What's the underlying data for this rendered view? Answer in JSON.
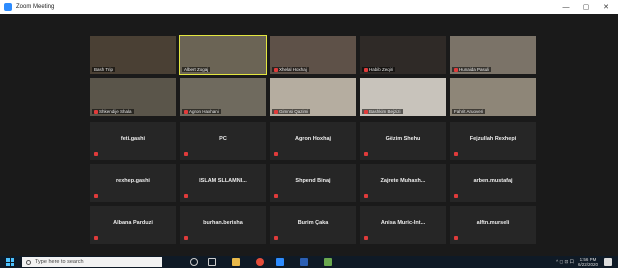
{
  "window": {
    "title": "Zoom Meeting",
    "minimize": "—",
    "maximize": "▢",
    "close": "✕"
  },
  "video_tiles": [
    {
      "name": "Bash Trip",
      "muted": false,
      "active": false,
      "bg": "#4a4034"
    },
    {
      "name": "Albert Zogaj",
      "muted": false,
      "active": true,
      "bg": "#6b6455"
    },
    {
      "name": "Xhelal Hoxhaj",
      "muted": true,
      "active": false,
      "bg": "#5e5148"
    },
    {
      "name": "Habib Zeqiri",
      "muted": true,
      "active": false,
      "bg": "#2f2a27"
    },
    {
      "name": "Hunaida Pasuli",
      "muted": true,
      "active": false,
      "bg": "#7b7368"
    },
    {
      "name": "Shkendije Shala",
      "muted": true,
      "active": false,
      "bg": "#5a554a"
    },
    {
      "name": "Agron Haxhani",
      "muted": true,
      "active": false,
      "bg": "#6f6a5e"
    },
    {
      "name": "Gimnsi Qazimi",
      "muted": true,
      "active": false,
      "bg": "#b5ada0"
    },
    {
      "name": "Bashkim Bejzizi",
      "muted": true,
      "active": false,
      "bg": "#c8c3bb"
    },
    {
      "name": "Fahrit Aruoveri",
      "muted": false,
      "active": false,
      "bg": "#8e8678"
    }
  ],
  "name_tiles": [
    "feti.gashi",
    "PC",
    "Agron Hoxhaj",
    "Gëzim Shehu",
    "Fejzullah Rexhepi",
    "rexhep.gashi",
    "ISLAM SLLAMNI...",
    "Shpend Binaj",
    "Zajrete Muhaxh...",
    "arben.mustafaj",
    "Albana Parduzi",
    "burhan.berisha",
    "Burim Çaka",
    "Anisa Muric-Int...",
    "alftn.murseli"
  ],
  "taskbar": {
    "search_placeholder": "Type here to search",
    "time": "1:56 PM",
    "date": "6/22/2020",
    "tray_text": "^ ◻ ⊡ 口"
  },
  "colors": {
    "mute": "#e03b3b",
    "active_border": "#e3e640",
    "stage": "#1a1a1a",
    "tile": "#262626"
  },
  "icons": [
    "windows-logo-icon",
    "search-icon",
    "task-view-icon",
    "file-explorer-icon",
    "chrome-icon",
    "zoom-icon",
    "word-icon",
    "app-icon"
  ]
}
